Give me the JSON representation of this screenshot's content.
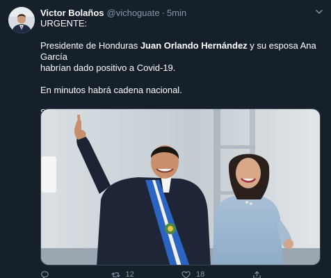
{
  "tweet": {
    "author_name": "Victor Bolaños",
    "handle": "@vichoguate",
    "separator": "·",
    "time": "5min",
    "line1": "URGENTE:",
    "line2_pre": "Presidente de Honduras ",
    "line2_bold": "Juan Orlando Hernández",
    "line2_post": " y su esposa Ana García",
    "line3": "habrían dado positivo a Covid-19.",
    "line4": "En minutos habrá cadena nacional.",
    "line5": "Serán atendidos en el hospital militar de dicho pais."
  },
  "actions": {
    "reply_count": "",
    "retweet_count": "12",
    "like_count": "18"
  },
  "icons": {
    "more": "chevron-down-icon",
    "reply": "reply-icon",
    "retweet": "retweet-icon",
    "like": "heart-icon",
    "share": "share-icon"
  },
  "colors": {
    "background": "#15202b",
    "muted": "#8899a6",
    "text": "#ffffff"
  }
}
